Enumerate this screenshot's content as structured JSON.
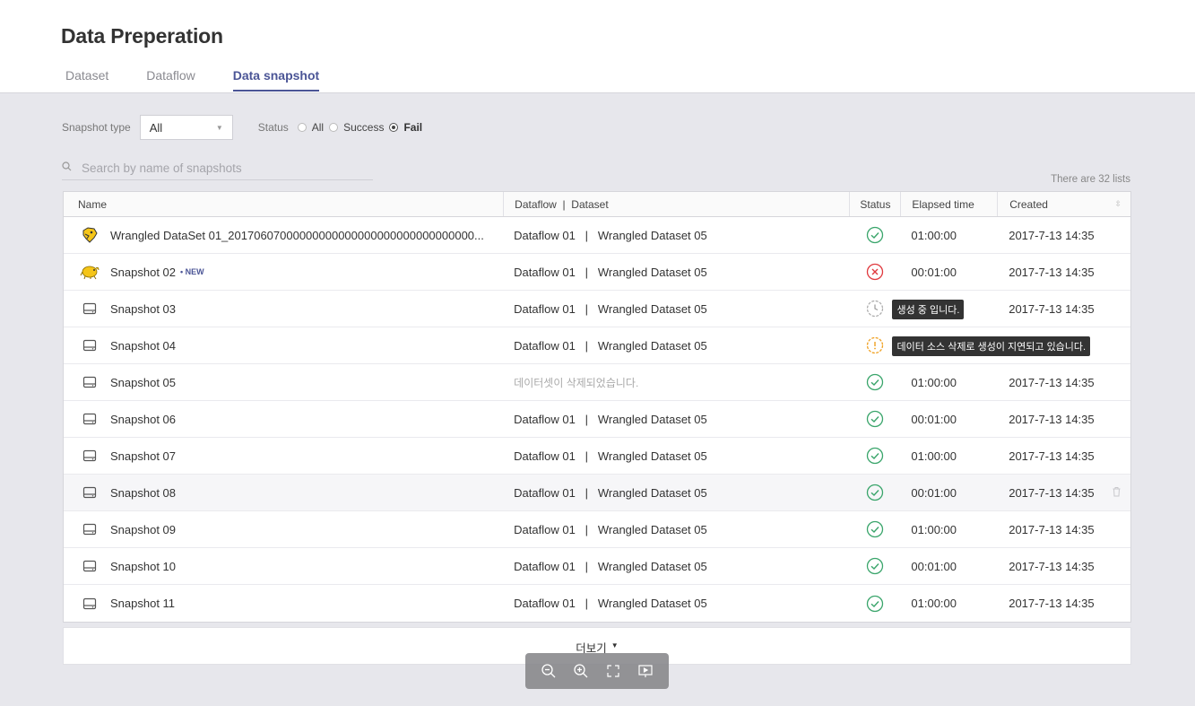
{
  "page": {
    "title": "Data Preperation"
  },
  "tabs": [
    {
      "label": "Dataset",
      "active": false
    },
    {
      "label": "Dataflow",
      "active": false
    },
    {
      "label": "Data snapshot",
      "active": true
    }
  ],
  "filters": {
    "snapshot_type_label": "Snapshot type",
    "snapshot_type_value": "All",
    "status_label": "Status",
    "status_options": [
      "All",
      "Success",
      "Fail"
    ],
    "status_selected": "Fail"
  },
  "search": {
    "placeholder": "Search by name of snapshots",
    "value": ""
  },
  "list_count": "There are 32 lists",
  "table": {
    "headers": {
      "name": "Name",
      "dataflow": "Dataflow  |  Dataset",
      "status": "Status",
      "elapsed": "Elapsed time",
      "created": "Created"
    },
    "rows": [
      {
        "icon": "hive-icon",
        "name": "Wrangled DataSet 01_20170607000000000000000000000000000000...",
        "new": "",
        "dataflow": "Dataflow 01   |   Wrangled Dataset 05",
        "status": "success",
        "tooltip": "",
        "elapsed": "01:00:00",
        "created": "2017-7-13 14:35"
      },
      {
        "icon": "hadoop-icon",
        "name": "Snapshot 02",
        "new": "• NEW",
        "dataflow": "Dataflow 01   |   Wrangled Dataset 05",
        "status": "fail",
        "tooltip": "",
        "elapsed": "00:01:00",
        "created": "2017-7-13 14:35"
      },
      {
        "icon": "storage-icon",
        "name": "Snapshot 03",
        "new": "",
        "dataflow": "Dataflow 01   |   Wrangled Dataset 05",
        "status": "pending",
        "tooltip": "생성 중 입니다.",
        "elapsed": "",
        "created": "2017-7-13 14:35"
      },
      {
        "icon": "storage-icon",
        "name": "Snapshot 04",
        "new": "",
        "dataflow": "Dataflow 01   |   Wrangled Dataset 05",
        "status": "warning",
        "tooltip": "데이터 소스 삭제로 생성이 지연되고 있습니다.",
        "elapsed": "",
        "created": ""
      },
      {
        "icon": "storage-icon",
        "name": "Snapshot 05",
        "new": "",
        "dataflow": "데이터셋이 삭제되었습니다.",
        "deleted": true,
        "status": "success",
        "tooltip": "",
        "elapsed": "01:00:00",
        "created": "2017-7-13 14:35"
      },
      {
        "icon": "storage-icon",
        "name": "Snapshot 06",
        "new": "",
        "dataflow": "Dataflow 01   |   Wrangled Dataset 05",
        "status": "success",
        "tooltip": "",
        "elapsed": "00:01:00",
        "created": "2017-7-13 14:35"
      },
      {
        "icon": "storage-icon",
        "name": "Snapshot 07",
        "new": "",
        "dataflow": "Dataflow 01   |   Wrangled Dataset 05",
        "status": "success",
        "tooltip": "",
        "elapsed": "01:00:00",
        "created": "2017-7-13 14:35"
      },
      {
        "icon": "storage-icon",
        "name": "Snapshot 08",
        "new": "",
        "dataflow": "Dataflow 01   |   Wrangled Dataset 05",
        "status": "success",
        "tooltip": "",
        "elapsed": "00:01:00",
        "created": "2017-7-13 14:35",
        "hover": true
      },
      {
        "icon": "storage-icon",
        "name": "Snapshot 09",
        "new": "",
        "dataflow": "Dataflow 01   |   Wrangled Dataset 05",
        "status": "success",
        "tooltip": "",
        "elapsed": "01:00:00",
        "created": "2017-7-13 14:35"
      },
      {
        "icon": "storage-icon",
        "name": "Snapshot 10",
        "new": "",
        "dataflow": "Dataflow 01   |   Wrangled Dataset 05",
        "status": "success",
        "tooltip": "",
        "elapsed": "00:01:00",
        "created": "2017-7-13 14:35"
      },
      {
        "icon": "storage-icon",
        "name": "Snapshot 11",
        "new": "",
        "dataflow": "Dataflow 01   |   Wrangled Dataset 05",
        "status": "success",
        "tooltip": "",
        "elapsed": "01:00:00",
        "created": "2017-7-13 14:35"
      }
    ]
  },
  "more_button": {
    "label": "더보기"
  },
  "zoom_toolbar": [
    "zoom-out-icon",
    "zoom-in-icon",
    "fit-screen-icon",
    "present-icon"
  ],
  "colors": {
    "accent": "#4b5596",
    "success": "#3aa56b",
    "fail": "#e0393e",
    "warning": "#f0a020",
    "pending": "#999999"
  }
}
